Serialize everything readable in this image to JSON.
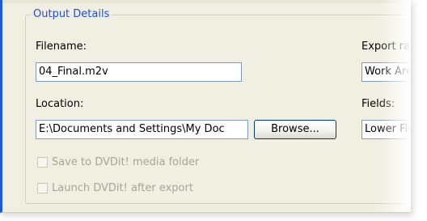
{
  "output_details": {
    "group_title": "Output Details",
    "filename": {
      "label": "Filename:",
      "value": "04_Final.m2v"
    },
    "location": {
      "label": "Location:",
      "value": "E:\\Documents and Settings\\My Doc",
      "browse_label": "Browse..."
    },
    "save_to_media_folder": {
      "label": "Save to DVDit! media folder",
      "checked": false,
      "enabled": false
    },
    "launch_after_export": {
      "label": "Launch DVDit! after export",
      "checked": false,
      "enabled": false
    },
    "export_range": {
      "label": "Export range",
      "value": "Work Area"
    },
    "fields": {
      "label": "Fields:",
      "value": "Lower Field"
    }
  }
}
